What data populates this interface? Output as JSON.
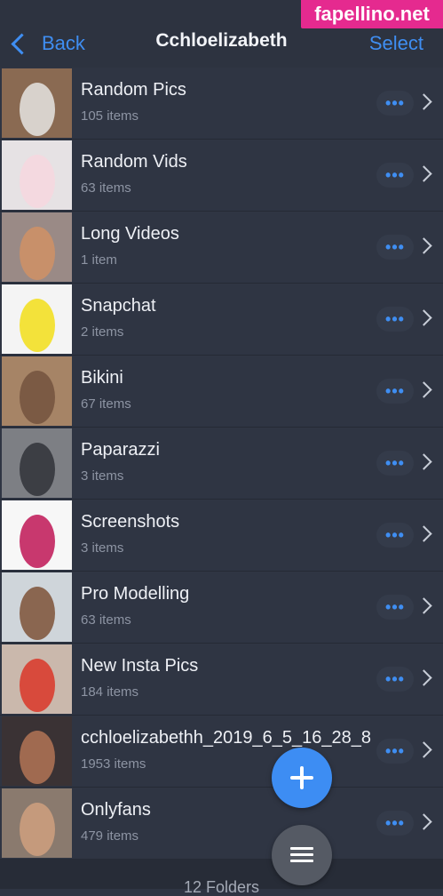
{
  "header": {
    "back_label": "Back",
    "title": "Cchloelizabeth",
    "select_label": "Select"
  },
  "watermark": "fapellino.net",
  "folders": [
    {
      "name": "Random Pics",
      "count": "105 items",
      "thumb": {
        "bg": "#8a6a52",
        "fg": "#d8d2cc"
      }
    },
    {
      "name": "Random Vids",
      "count": "63 items",
      "thumb": {
        "bg": "#e6e2e4",
        "fg": "#f4d9e0"
      }
    },
    {
      "name": "Long Videos",
      "count": "1 item",
      "thumb": {
        "bg": "#9a8a86",
        "fg": "#c8906a"
      }
    },
    {
      "name": "Snapchat",
      "count": "2 items",
      "thumb": {
        "bg": "#f4f4f4",
        "fg": "#f3e23a"
      }
    },
    {
      "name": "Bikini",
      "count": "67 items",
      "thumb": {
        "bg": "#a68466",
        "fg": "#7b5a44"
      }
    },
    {
      "name": "Paparazzi",
      "count": "3 items",
      "thumb": {
        "bg": "#7d7f84",
        "fg": "#3c3e44"
      }
    },
    {
      "name": "Screenshots",
      "count": "3 items",
      "thumb": {
        "bg": "#f7f7f7",
        "fg": "#c8386e"
      }
    },
    {
      "name": "Pro Modelling",
      "count": "63 items",
      "thumb": {
        "bg": "#cfd5da",
        "fg": "#8a6650"
      }
    },
    {
      "name": "New Insta Pics",
      "count": "184 items",
      "thumb": {
        "bg": "#cab8ac",
        "fg": "#d84a3c"
      }
    },
    {
      "name": "cchloelizabethh_2019_6_5_16_28_8",
      "count": "1953 items",
      "thumb": {
        "bg": "#3a3234",
        "fg": "#a06a50"
      }
    },
    {
      "name": "Onlyfans",
      "count": "479 items",
      "thumb": {
        "bg": "#8a7a6e",
        "fg": "#c59a7c"
      }
    }
  ],
  "more_glyph": "•••",
  "footer": {
    "label": "12 Folders"
  },
  "colors": {
    "accent": "#3f8ef2",
    "background": "#2f3543",
    "fab_add": "#3d8df3",
    "fab_menu": "#555a64"
  }
}
